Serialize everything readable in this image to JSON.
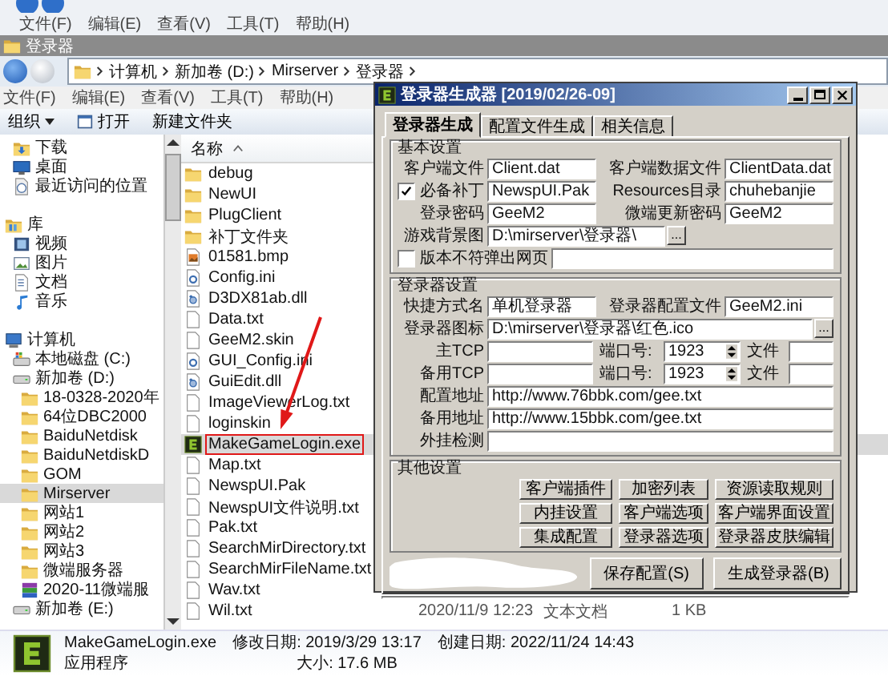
{
  "background_window": {
    "menu": [
      "文件(F)",
      "编辑(E)",
      "查看(V)",
      "工具(T)",
      "帮助(H)"
    ]
  },
  "window": {
    "title": "登录器",
    "breadcrumb": [
      "计算机",
      "新加卷 (D:)",
      "Mirserver",
      "登录器"
    ],
    "menu": [
      "文件(F)",
      "编辑(E)",
      "查看(V)",
      "工具(T)",
      "帮助(H)"
    ],
    "toolbar": [
      {
        "label": "组织",
        "kind": "dropdown"
      },
      {
        "label": "打开",
        "kind": "open"
      },
      {
        "label": "新建文件夹",
        "kind": "plain"
      }
    ]
  },
  "nav": {
    "favorites": [
      {
        "label": "下载",
        "kind": "download",
        "selected": false
      },
      {
        "label": "桌面",
        "kind": "desktop",
        "selected": false
      },
      {
        "label": "最近访问的位置",
        "kind": "recent",
        "selected": false
      }
    ],
    "tree": [
      {
        "label": "库",
        "kind": "library",
        "selected": false,
        "children": [
          {
            "label": "视频",
            "kind": "video",
            "selected": false
          },
          {
            "label": "图片",
            "kind": "picture",
            "selected": false
          },
          {
            "label": "文档",
            "kind": "document",
            "selected": false
          },
          {
            "label": "音乐",
            "kind": "music",
            "selected": false
          }
        ]
      },
      {
        "label": "计算机",
        "kind": "computer",
        "selected": false,
        "children": [
          {
            "label": "本地磁盘 (C:)",
            "kind": "system_drive",
            "selected": false
          },
          {
            "label": "新加卷 (D:)",
            "kind": "drive",
            "selected": false,
            "children": [
              {
                "label": "18-0328-2020年",
                "kind": "folder",
                "selected": false
              },
              {
                "label": "64位DBC2000",
                "kind": "folder",
                "selected": false
              },
              {
                "label": "BaiduNetdisk",
                "kind": "folder",
                "selected": false
              },
              {
                "label": "BaiduNetdiskD",
                "kind": "folder",
                "selected": false
              },
              {
                "label": "GOM",
                "kind": "folder",
                "selected": false
              },
              {
                "label": "Mirserver",
                "kind": "folder",
                "selected": true
              },
              {
                "label": "网站1",
                "kind": "folder",
                "selected": false
              },
              {
                "label": "网站2",
                "kind": "folder",
                "selected": false
              },
              {
                "label": "网站3",
                "kind": "folder",
                "selected": false
              },
              {
                "label": "微端服务器",
                "kind": "folder",
                "selected": false
              },
              {
                "label": "2020-11微端服",
                "kind": "archive",
                "selected": false
              }
            ]
          },
          {
            "label": "新加卷 (E:)",
            "kind": "drive",
            "selected": false
          }
        ]
      }
    ]
  },
  "files": {
    "header": "名称",
    "rows": [
      {
        "name": "debug",
        "kind": "folder",
        "selected": false
      },
      {
        "name": "NewUI",
        "kind": "folder",
        "selected": false
      },
      {
        "name": "PlugClient",
        "kind": "folder",
        "selected": false
      },
      {
        "name": "补丁文件夹",
        "kind": "folder",
        "selected": false
      },
      {
        "name": "01581.bmp",
        "kind": "image",
        "selected": false
      },
      {
        "name": "Config.ini",
        "kind": "config",
        "selected": false
      },
      {
        "name": "D3DX81ab.dll",
        "kind": "dll",
        "selected": false
      },
      {
        "name": "Data.txt",
        "kind": "text",
        "selected": false
      },
      {
        "name": "GeeM2.skin",
        "kind": "text",
        "selected": false
      },
      {
        "name": "GUI_Config.ini",
        "kind": "config",
        "selected": false
      },
      {
        "name": "GuiEdit.dll",
        "kind": "dll",
        "selected": false
      },
      {
        "name": "ImageViewerLog.txt",
        "kind": "text",
        "selected": false
      },
      {
        "name": "loginskin",
        "kind": "text",
        "selected": false
      },
      {
        "name": "MakeGameLogin.exe",
        "kind": "exe",
        "selected": true,
        "annotated": true
      },
      {
        "name": "Map.txt",
        "kind": "text",
        "selected": false
      },
      {
        "name": "NewspUI.Pak",
        "kind": "text",
        "selected": false
      },
      {
        "name": "NewspUI文件说明.txt",
        "kind": "text",
        "selected": false
      },
      {
        "name": "Pak.txt",
        "kind": "text",
        "selected": false
      },
      {
        "name": "SearchMirDirectory.txt",
        "kind": "text",
        "selected": false
      },
      {
        "name": "SearchMirFileName.txt",
        "kind": "text",
        "selected": false
      },
      {
        "name": "Wav.txt",
        "kind": "text",
        "selected": false
      },
      {
        "name": "Wil.txt",
        "kind": "text",
        "selected": false,
        "date": "2020/11/9 12:23",
        "type": "文本文档",
        "size": "1 KB"
      }
    ]
  },
  "details": {
    "name": "MakeGameLogin.exe",
    "modified": "修改日期: 2019/3/29 13:17",
    "type": "应用程序",
    "size": "大小: 17.6 MB",
    "created": "创建日期: 2022/11/24 14:43"
  },
  "dialog": {
    "title": "登录器生成器 [2019/02/26-09]",
    "tabs": [
      {
        "label": "登录器生成",
        "selected": true
      },
      {
        "label": "配置文件生成",
        "selected": false
      },
      {
        "label": "相关信息",
        "selected": false
      }
    ],
    "groups": [
      {
        "title": "基本设置",
        "rows": [
          {
            "kind": "pair",
            "fields": [
              {
                "kind": "text",
                "label": "客户端文件",
                "value": "Client.dat"
              },
              {
                "kind": "text",
                "label": "客户端数据文件",
                "value": "ClientData.dat"
              }
            ]
          },
          {
            "kind": "pair",
            "fields": [
              {
                "kind": "check",
                "label": "必备补丁",
                "checked": true,
                "value": "NewspUI.Pak"
              },
              {
                "kind": "text",
                "label": "Resources目录",
                "value": "chuhebanjie"
              }
            ]
          },
          {
            "kind": "pair",
            "fields": [
              {
                "kind": "text",
                "label": "登录密码",
                "value": "GeeM2"
              },
              {
                "kind": "text",
                "label": "微端更新密码",
                "value": "GeeM2"
              }
            ]
          },
          {
            "kind": "half",
            "fields": [
              {
                "kind": "browse",
                "label": "游戏背景图",
                "value": "D:\\mirserver\\登录器\\",
                "button": "..."
              }
            ]
          },
          {
            "kind": "check_wide",
            "fields": [
              {
                "kind": "check",
                "label": "版本不符弹出网页",
                "checked": false
              }
            ]
          }
        ]
      },
      {
        "title": "登录器设置",
        "rows": [
          {
            "kind": "pair",
            "fields": [
              {
                "kind": "text",
                "label": "快捷方式名",
                "value": "单机登录器"
              },
              {
                "kind": "text",
                "label": "登录器配置文件",
                "value": "GeeM2.ini"
              }
            ]
          },
          {
            "kind": "wide",
            "fields": [
              {
                "kind": "browse",
                "label": "登录器图标",
                "value": "D:\\mirserver\\登录器\\红色.ico",
                "button": "..."
              }
            ]
          },
          {
            "kind": "tcp",
            "fields": [
              {
                "kind": "text",
                "label": "主TCP"
              },
              {
                "kind": "spin",
                "label": "端口号:",
                "value": "1923"
              },
              {
                "kind": "text",
                "label": "文件"
              }
            ]
          },
          {
            "kind": "tcp",
            "fields": [
              {
                "kind": "text",
                "label": "备用TCP"
              },
              {
                "kind": "spin",
                "label": "端口号:",
                "value": "1923"
              },
              {
                "kind": "text",
                "label": "文件"
              }
            ]
          },
          {
            "kind": "wide",
            "fields": [
              {
                "kind": "text",
                "label": "配置地址",
                "value": "http://www.76bbk.com/gee.txt"
              }
            ]
          },
          {
            "kind": "wide",
            "fields": [
              {
                "kind": "text",
                "label": "备用地址",
                "value": "http://www.15bbk.com/gee.txt"
              }
            ]
          },
          {
            "kind": "wide",
            "fields": [
              {
                "kind": "text",
                "label": "外挂检测"
              }
            ]
          }
        ]
      }
    ],
    "other": {
      "title": "其他设置",
      "buttons": [
        "客户端插件",
        "加密列表",
        "资源读取规则",
        "内挂设置",
        "客户端选项",
        "客户端界面设置",
        "集成配置",
        "登录器选项",
        "登录器皮肤编辑"
      ]
    },
    "actions": [
      "保存配置(S)",
      "生成登录器(B)"
    ]
  }
}
